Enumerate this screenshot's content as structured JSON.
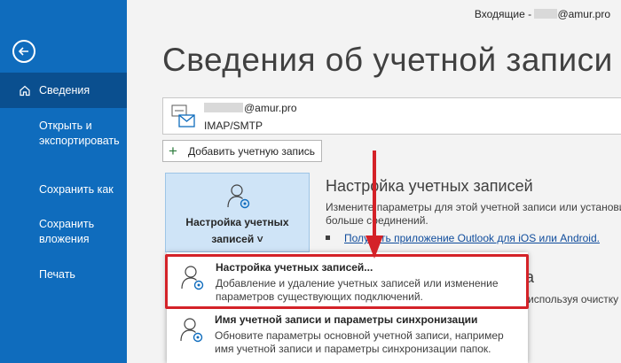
{
  "sidebar": {
    "active_item": "Сведения",
    "items": [
      {
        "label": "Открыть и экспортировать"
      },
      {
        "label": "Сохранить как"
      },
      {
        "label": "Сохранить вложения"
      },
      {
        "label": "Печать"
      }
    ]
  },
  "topbar": {
    "folder_label": "Входящие - ",
    "domain": "@amur.pro"
  },
  "page_title": "Сведения об учетной записи",
  "account": {
    "email_domain": "@amur.pro",
    "type": "IMAP/SMTP"
  },
  "add_account_label": "Добавить учетную запись",
  "settings_tile": {
    "label_line1": "Настройка учетных",
    "label_line2": "записей ˅"
  },
  "section": {
    "heading": "Настройка учетных записей",
    "desc_line1": "Измените параметры для этой учетной записи или установи",
    "desc_line2": "больше соединений.",
    "link": "Получить приложение Outlook для iOS или Android."
  },
  "partial": {
    "heading": "а",
    "text": "используя очистку"
  },
  "dropdown": {
    "items": [
      {
        "title": "Настройка учетных записей...",
        "description": "Добавление и удаление учетных записей или изменение параметров существующих подключений."
      },
      {
        "title": "Имя учетной записи и параметры синхронизации",
        "description": "Обновите параметры основной учетной записи, например имя учетной записи и параметры синхронизации папок."
      }
    ]
  },
  "colors": {
    "sidebar": "#0f6cbd",
    "sidebar_active": "#0a4f8f",
    "highlight": "#d42228",
    "tile": "#cfe4f7",
    "link": "#0f4c9c"
  }
}
